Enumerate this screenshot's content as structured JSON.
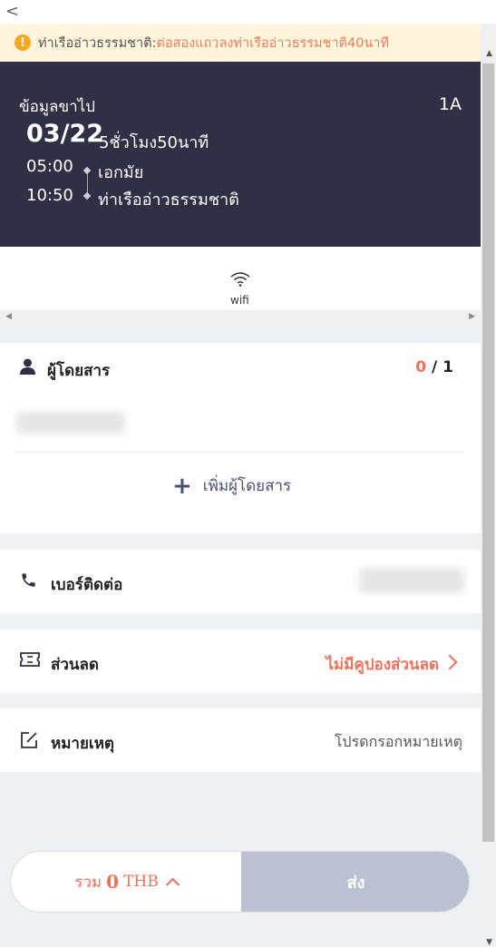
{
  "nav": {
    "back_glyph": "<"
  },
  "notice": {
    "title": "ท่าเรืออ่าวธรรมชาติ:",
    "message": "ต่อสองแถวลงท่าเรืออ่าวธรรมชาติ40นาที",
    "icon": "warning-icon",
    "color": "#f07a56"
  },
  "trip": {
    "title": "ข้อมูลขาไป",
    "seat": "1A",
    "date": "03/22",
    "duration": "5ชั่วโมง50นาที",
    "departure": {
      "time": "05:00",
      "station": "เอกมัย"
    },
    "arrival": {
      "time": "10:50",
      "station": "ท่าเรืออ่าวธรรมชาติ"
    },
    "background": "#2f3046"
  },
  "amenities": [
    {
      "icon": "wifi-icon",
      "label": "wifi"
    }
  ],
  "passengers": {
    "label": "ผู้โดยสาร",
    "current": "0",
    "separator": " / ",
    "max": "1",
    "add_label": "เพิ่มผู้โดยสาร"
  },
  "contact": {
    "label": "เบอร์ติดต่อ"
  },
  "discount": {
    "label": "ส่วนลด",
    "value": "ไม่มีคูปองส่วนลด"
  },
  "remark": {
    "label": "หมายเหตุ",
    "placeholder": "โปรดกรอกหมายเหตุ"
  },
  "footer": {
    "total_prefix": "รวม",
    "total_amount": "0",
    "currency": "THB",
    "submit_label": "ส่ง",
    "accent": "#f0705a"
  }
}
